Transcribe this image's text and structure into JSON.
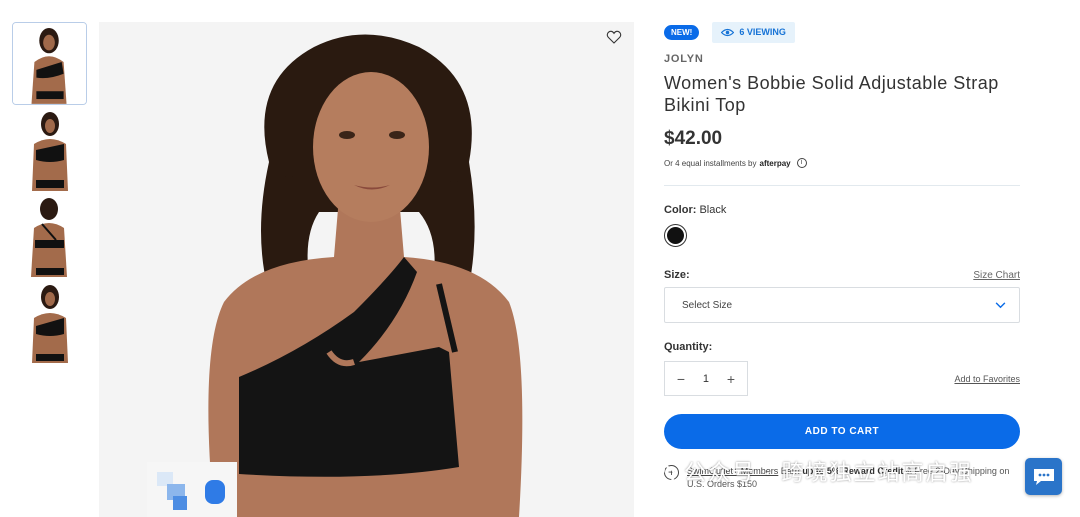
{
  "gallery": {
    "thumbnails": [
      "thumbnail-front-view",
      "thumbnail-angle-view",
      "thumbnail-back-view",
      "thumbnail-side-view"
    ],
    "main_image": "model-wearing-black-one-shoulder-bikini-top"
  },
  "badges": {
    "new": "NEW!",
    "viewing": "6 VIEWING"
  },
  "product": {
    "brand": "JOLYN",
    "title": "Women's Bobbie Solid Adjustable Strap Bikini Top",
    "price": "$42.00",
    "installments_text": "Or 4 equal installments by",
    "installments_provider": "afterpay"
  },
  "color": {
    "label": "Color:",
    "selected": "Black",
    "swatch_hex": "#111111"
  },
  "size": {
    "label": "Size:",
    "chart_link": "Size Chart",
    "select_placeholder": "Select Size"
  },
  "quantity": {
    "label": "Quantity:",
    "value": "1",
    "minus": "−",
    "plus": "+"
  },
  "favorites_link": "Add to Favorites",
  "add_to_cart": "ADD TO CART",
  "membership": {
    "link": "SwimOutlet+ Members",
    "text_1": "Earn",
    "highlight": "up to 5% Reward Credit",
    "text_2": "& Free 2-Day Shipping on U.S. Orders $150"
  },
  "watermark": "公众号 · 跨境独立站高启强",
  "colors": {
    "accent": "#0a6be8",
    "viewing_bg": "#e6f2fb"
  }
}
